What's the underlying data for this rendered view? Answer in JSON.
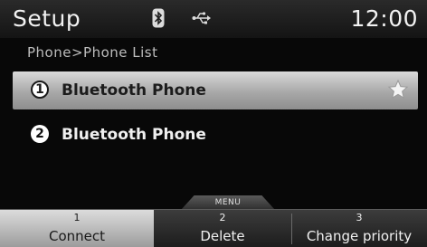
{
  "header": {
    "title": "Setup",
    "time": "12:00",
    "icons": [
      "bluetooth-icon",
      "usb-icon"
    ]
  },
  "breadcrumb": "Phone>Phone List",
  "list": {
    "items": [
      {
        "number": "1",
        "label": "Bluetooth Phone",
        "selected": true,
        "favorite_icon": "star-icon"
      },
      {
        "number": "2",
        "label": "Bluetooth Phone",
        "selected": false
      }
    ]
  },
  "menu_tab": "MENU",
  "softkeys": [
    {
      "number": "1",
      "label": "Connect"
    },
    {
      "number": "2",
      "label": "Delete"
    },
    {
      "number": "3",
      "label": "Change priority"
    }
  ],
  "colors": {
    "background": "#080808",
    "selected_row": "#a8a8a8",
    "text": "#e8e8e8"
  }
}
